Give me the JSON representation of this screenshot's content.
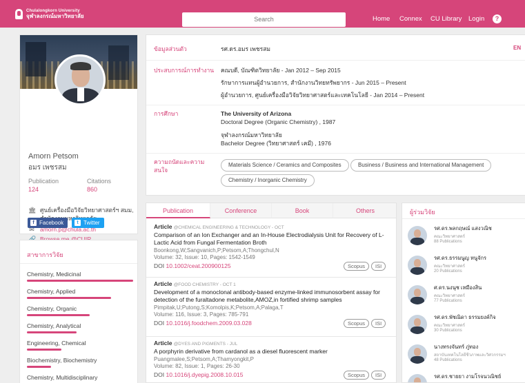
{
  "header": {
    "logo_en": "Chulalongkorn University",
    "logo_th": "จุฬาลงกรณ์มหาวิทยาลัย",
    "search_placeholder": "Search",
    "nav": [
      "Home",
      "Connex",
      "CU Library",
      "Login"
    ],
    "help": "?"
  },
  "profile": {
    "name_en": "Amorn Petsom",
    "name_th": "อมร เพชรสม",
    "publication_label": "Publication",
    "publication_count": "124",
    "citations_label": "Citations",
    "citations_count": "860",
    "affiliation_line1": "ศูนย์เครื่องมือวิจัยวิทยาศาสตร์ฯ สมม,",
    "affiliation_line2": "สำนักงานมหาวิทยาลัย",
    "email": "amorn.p@chula.ac.th",
    "browse": "Browse me @CUIR",
    "facebook": "Facebook",
    "twitter": "Twitter"
  },
  "fields": {
    "title": "สาขาการวิจัย",
    "items": [
      {
        "label": "Chemistry, Medicinal",
        "level": 0.96
      },
      {
        "label": "Chemistry, Applied",
        "level": 0.76
      },
      {
        "label": "Chemistry, Organic",
        "level": 0.57
      },
      {
        "label": "Chemistry, Analytical",
        "level": 0.45
      },
      {
        "label": "Engineering, Chemical",
        "level": 0.31
      },
      {
        "label": "Biochemistry, Biochemistry",
        "level": 0.22
      },
      {
        "label": "Chemistry, Multidisciplinary",
        "level": 0.2
      }
    ]
  },
  "details": {
    "personal_label": "ข้อมูลส่วนตัว",
    "personal_value": "รศ.ดร.อมร เพชรสม",
    "lang": "EN",
    "work_label": "ประสบการณ์การทำงาน",
    "work": [
      "คณบดี, บัณฑิตวิทยาลัย - Jan 2012 – Sep 2015",
      "รักษาการแทนผู้อำนวยการ, สำนักงานวิทยทรัพยากร - Jun 2015 – Present",
      "ผู้อำนวยการ, ศูนย์เครื่องมือวิจัยวิทยาศาสตร์และเทคโนโลยี - Jan 2014 – Present"
    ],
    "edu_label": "การศึกษา",
    "edu1_school": "The University of Arizona",
    "edu1_degree": "Doctoral Degree (Organic Chemistry) , 1987",
    "edu2_school": "จุฬาลงกรณ์มหาวิทยาลัย",
    "edu2_degree": "Bachelor Degree (วิทยาศาสตร์ เคมี) , 1976",
    "interest_label_line1": "ความถนัดและความ",
    "interest_label_line2": "สนใจ",
    "interests": [
      "Materials Science / Ceramics and Composites",
      "Business / Business and International Management",
      "Chemistry / Inorganic Chemistry"
    ]
  },
  "pub_tabs": [
    "Publication",
    "Conference",
    "Book",
    "Others"
  ],
  "publications": [
    {
      "type": "Article",
      "venue": "@CHEMICAL ENGINEERING & TECHNOLOGY - OCT",
      "title": "Comparison of an Ion Exchanger and an In-House Electrodialysis Unit for Recovery of L-Lactic Acid from Fungal Fermentation Broth",
      "authors": "Boonkong,W;Sangvanich,P;Petsom,A;Thongchul,N",
      "volume": "Volume: 32, Issue: 10, Pages: 1542-1549",
      "doi_label": "DOI",
      "doi": "10.1002/ceat.200900125",
      "badges": [
        "Scopus",
        "ISI"
      ]
    },
    {
      "type": "Article",
      "venue": "@FOOD CHEMISTRY - OCT 1",
      "title": "Development of a monoclonal antibody-based enzyme-linked immunosorbent assay for detection of the furaltadone metabolite,AMOZ,in fortified shrimp samples",
      "authors": "Pimpitak,U;Putong,S;Komolpis,K;Petsom,A;Palaga,T",
      "volume": "Volume: 116, Issue: 3, Pages: 785-791",
      "doi_label": "DOI",
      "doi": "10.1016/j.foodchem.2009.03.028",
      "badges": [
        "Scopus",
        "ISI"
      ]
    },
    {
      "type": "Article",
      "venue": "@DYES AND PIGMENTS - JUL",
      "title": "A porphyrin derivative from cardanol as a diesel fluorescent marker",
      "authors": "Puangmalee,S;Petsom,A;Thamyongkit,P",
      "volume": "Volume: 82, Issue: 1, Pages: 26-30",
      "doi_label": "DOI",
      "doi": "10.1016/j.dyepig.2008.10.015",
      "badges": [
        "Scopus",
        "ISI"
      ]
    }
  ],
  "coresearchers": {
    "title": "ผู้ร่วมวิจัย",
    "people": [
      {
        "name": "รศ.ดร.พลกฤษณ์ แสงวณิช",
        "dept": "คณะวิทยาศาสตร์",
        "count": "88 Publications"
      },
      {
        "name": "รศ.ดร.ธรรมนูญ หนูจักร",
        "dept": "คณะวิทยาศาสตร์",
        "count": "20 Publications"
      },
      {
        "name": "ศ.ดร.นงนุช เหมืองสิน",
        "dept": "คณะวิทยาศาสตร์",
        "count": "77 Publications"
      },
      {
        "name": "รศ.ดร.พัชณิดา ธรรมยงค์กิจ",
        "dept": "คณะวิทยาศาสตร์",
        "count": "30 Publications"
      },
      {
        "name": "นางทรงจันทร์ ภู่ทอง",
        "dept": "สถาบันเทคโนโลยีชีวภาพและวิศวกรรมฯ",
        "count": "48 Publications"
      },
      {
        "name": "รศ.ดร.ชายยา งามโรจนวณิชย์",
        "dept": "",
        "count": ""
      }
    ]
  },
  "colors": {
    "accent": "#d6457a",
    "facebook": "#3b5998",
    "twitter": "#1da1f2"
  }
}
